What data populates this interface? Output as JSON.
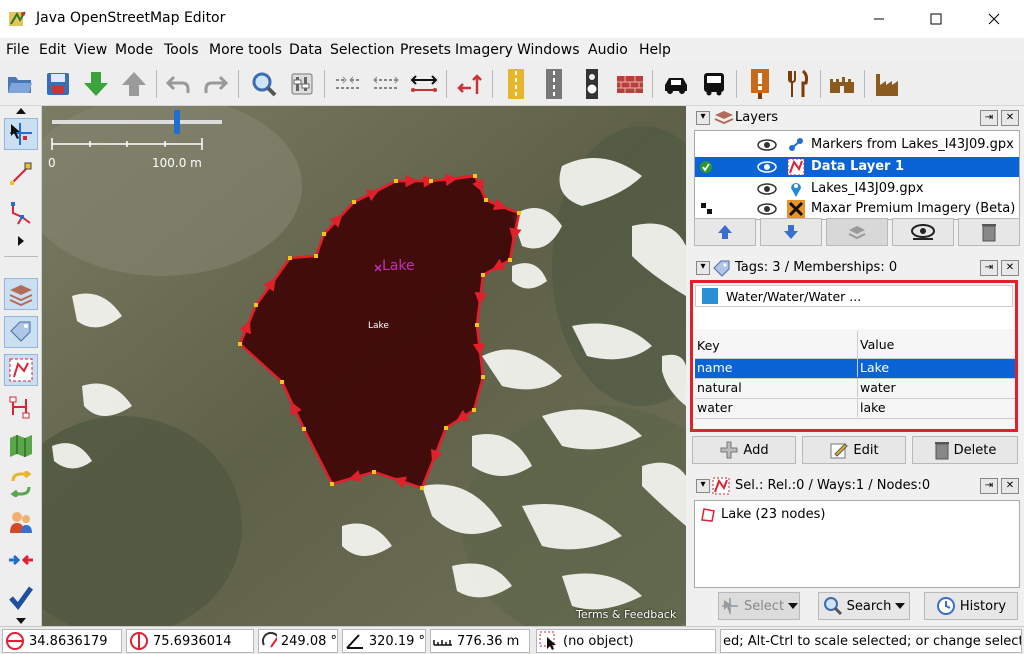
{
  "window": {
    "title": "Java OpenStreetMap Editor"
  },
  "menu": [
    "File",
    "Edit",
    "View",
    "Mode",
    "Tools",
    "More tools",
    "Data",
    "Selection",
    "Presets",
    "Imagery",
    "Windows",
    "Audio",
    "Help"
  ],
  "map": {
    "scale_start": "0",
    "scale_end": "100.0 m",
    "lake_label": "Lake",
    "area_label": "Lake",
    "attribution": "Terms & Feedback",
    "lake_fill": "#3e0505",
    "way_color": "#e0202a"
  },
  "layers": {
    "title": "Layers",
    "items": [
      {
        "name": "Markers from Lakes_I43J09.gpx"
      },
      {
        "name": "Data Layer 1"
      },
      {
        "name": "Lakes_I43J09.gpx"
      },
      {
        "name": "Maxar Premium Imagery (Beta)"
      }
    ]
  },
  "tags": {
    "title": "Tags: 3 / Memberships: 0",
    "preset": "Water/Water/Water ...",
    "header_key": "Key",
    "header_value": "Value",
    "rows": [
      {
        "key": "name",
        "value": "Lake"
      },
      {
        "key": "natural",
        "value": "water"
      },
      {
        "key": "water",
        "value": "lake"
      }
    ],
    "add": "Add",
    "edit": "Edit",
    "delete": "Delete"
  },
  "selection": {
    "title": "Sel.: Rel.:0 / Ways:1 / Nodes:0",
    "item": "Lake (23 nodes)",
    "select": "Select",
    "search": "Search",
    "history": "History"
  },
  "status": {
    "lat": "34.8636179",
    "lon": "75.6936014",
    "heading": "249.08 °",
    "angle": "320.19 °",
    "distance": "776.36 m",
    "object": "(no object)",
    "hint": "ed; Alt-Ctrl to scale selected; or change selection"
  },
  "colors": {
    "selection_blue": "#0a64d6",
    "highlight_red": "#e0202a"
  }
}
